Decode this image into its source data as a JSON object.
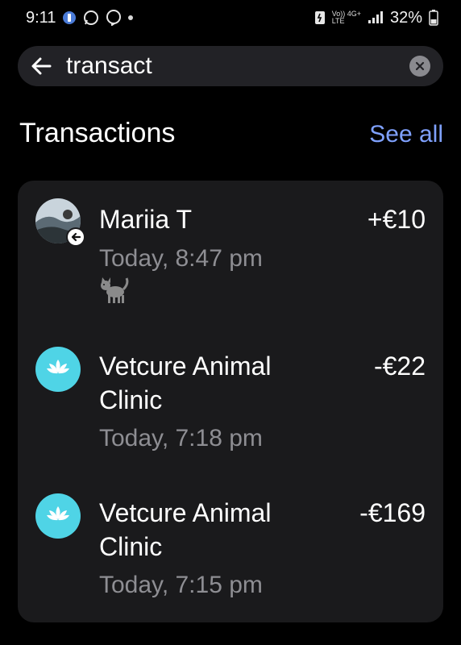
{
  "status_bar": {
    "time": "9:11",
    "network_top": "Vo)) 4G+",
    "network_bottom": "LTE",
    "battery": "32%"
  },
  "search": {
    "query": "transact",
    "back_icon": "arrow-left-icon",
    "clear_icon": "clear-x-icon"
  },
  "section": {
    "title": "Transactions",
    "see_all": "See all"
  },
  "transactions": [
    {
      "name": "Mariia T",
      "amount": "+€10",
      "time": "Today, 8:47 pm",
      "note_icon": "cat-emoji-icon",
      "avatar": "photo-avatar",
      "badge_icon": "incoming-arrow-icon"
    },
    {
      "name": "Vetcure Animal Clinic",
      "amount": "-€22",
      "time": "Today, 7:18 pm",
      "avatar": "lotus-icon"
    },
    {
      "name": "Vetcure Animal Clinic",
      "amount": "-€169",
      "time": "Today, 7:15 pm",
      "avatar": "lotus-icon"
    }
  ],
  "colors": {
    "background": "#000000",
    "card": "#1a1a1c",
    "search_bar": "#222226",
    "link": "#7fa1ff",
    "secondary_text": "#8e8e93",
    "merchant_icon_bg": "#4fd4e6"
  }
}
